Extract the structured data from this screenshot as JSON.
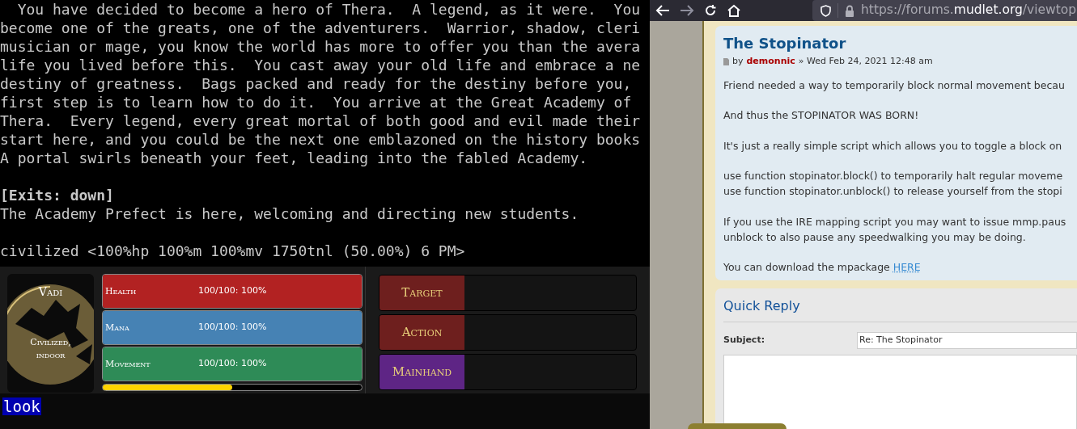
{
  "terminal": {
    "blocks": [
      {
        "lines": [
          {
            "text": "  You have decided to become a hero of Thera.  A legend, as it were.  You",
            "bold": false
          },
          {
            "text": "become one of the greats, one of the adventurers.  Warrior, shadow, cleri",
            "bold": false
          },
          {
            "text": "musician or mage, you know the world has more to offer you than the avera",
            "bold": false
          },
          {
            "text": "life you lived before this.  You cast away your old life and embrace a ne",
            "bold": false
          },
          {
            "text": "destiny of greatness.  Bags packed and ready for the destiny before you,",
            "bold": false
          },
          {
            "text": "first step is to learn how to do it.  You arrive at the Great Academy of",
            "bold": false
          },
          {
            "text": "Thera.  Every legend, every great mortal of both good and evil made their",
            "bold": false
          },
          {
            "text": "start here, and you could be the next one emblazoned on the history books",
            "bold": false
          },
          {
            "text": "A portal swirls beneath your feet, leading into the fabled Academy.",
            "bold": false
          }
        ]
      },
      {
        "lines": [
          {
            "text": "[Exits: down]",
            "bold": true
          },
          {
            "text": "The Academy Prefect is here, welcoming and directing new students.",
            "bold": false
          }
        ]
      },
      {
        "lines": [
          {
            "text": "civilized <100%hp 100%m 100%mv 1750tnl (50.00%) 6 PM>",
            "bold": false
          }
        ]
      }
    ]
  },
  "location": {
    "area": "Vadi",
    "room": "Civilized, indoor"
  },
  "gauges": [
    {
      "label": "Health",
      "reading": "100/100: 100%",
      "color": "#b22222",
      "level": 1
    },
    {
      "label": "Mana",
      "reading": "100/100: 100%",
      "color": "#4682b4",
      "level": 1
    },
    {
      "label": "Movement",
      "reading": "100/100: 100%",
      "color": "#2e8b57",
      "level": 1
    }
  ],
  "experience": {
    "level": 0.5
  },
  "slots": [
    {
      "label": "Target",
      "color": "#6e1f1e"
    },
    {
      "label": "Action",
      "color": "#6e1f1e"
    },
    {
      "label": "Mainhand",
      "color": "#5e2585"
    }
  ],
  "command_line": {
    "value": "look",
    "selected": true
  },
  "browser": {
    "url": {
      "prefix": "https://forums.",
      "domain": "mudlet.org",
      "suffix": "/viewtop"
    }
  },
  "post": {
    "title": "The Stopinator",
    "by": "by",
    "author": "demonnic",
    "date": "» Wed Feb 24, 2021 12:48 am",
    "paragraphs": [
      {
        "lines": [
          "Friend needed a way to temporarily block normal movement becau"
        ]
      },
      {
        "lines": [
          "And thus the STOPINATOR WAS BORN!"
        ]
      },
      {
        "lines": [
          "It's just a really simple script which allows you to toggle a block on"
        ]
      },
      {
        "lines": [
          "use function stopinator.block() to temporarily halt regular moveme",
          "use function stopinator.unblock() to release yourself from the stopi"
        ]
      },
      {
        "lines": [
          "If you use the IRE mapping script you may want to issue mmp.paus",
          "unblock to also pause any speedwalking you may be doing."
        ]
      },
      {
        "lines": [
          "You can download the mpackage"
        ],
        "link": "HERE"
      }
    ]
  },
  "quick_reply": {
    "title": "Quick Reply",
    "subject_label": "Subject:",
    "subject_value": "Re: The Stopinator"
  }
}
